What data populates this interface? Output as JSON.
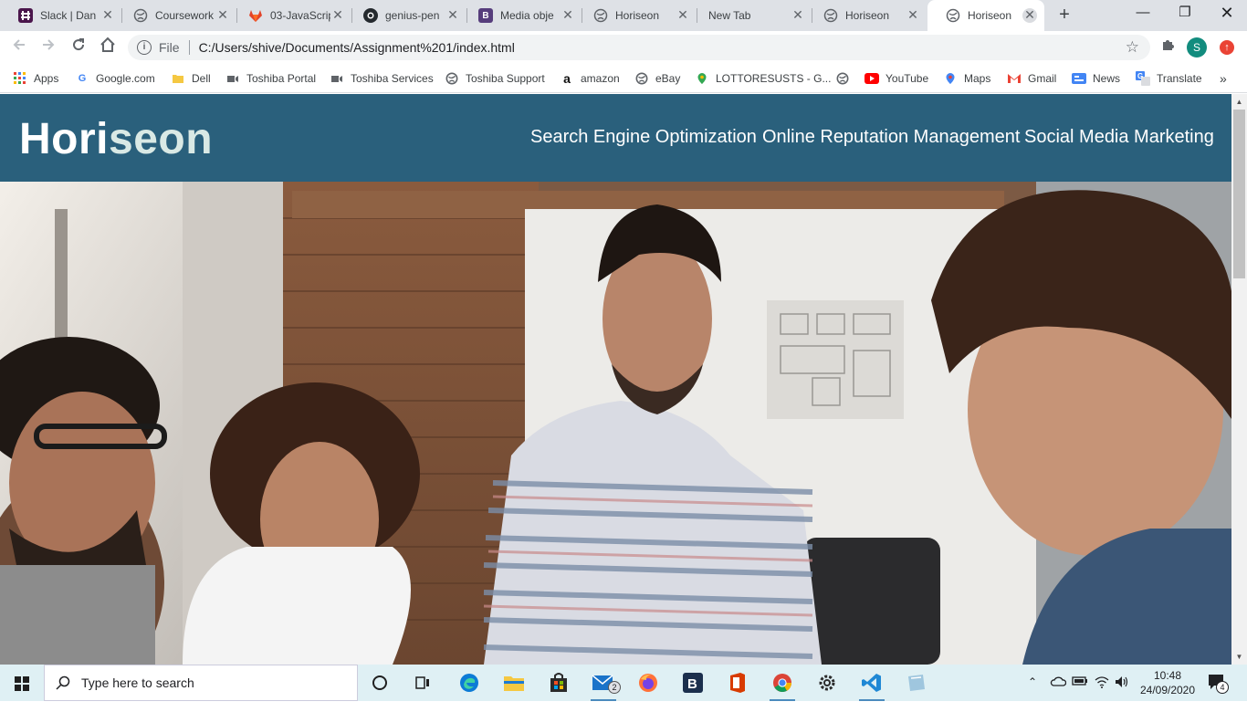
{
  "browser": {
    "tabs": [
      {
        "title": "Slack | Dan",
        "icon": "slack-icon"
      },
      {
        "title": "Coursework",
        "icon": "globe-icon"
      },
      {
        "title": "03-JavaScrip",
        "icon": "gitlab-icon"
      },
      {
        "title": "genius-pen",
        "icon": "github-icon"
      },
      {
        "title": "Media obje",
        "icon": "bootstrap-icon"
      },
      {
        "title": "Horiseon",
        "icon": "globe-icon"
      },
      {
        "title": "New Tab",
        "icon": ""
      },
      {
        "title": "Horiseon",
        "icon": "globe-icon"
      },
      {
        "title": "Horiseon",
        "icon": "globe-icon",
        "active": true
      }
    ],
    "address": {
      "scheme_label": "File",
      "url": "C:/Users/shive/Documents/Assignment%201/index.html"
    },
    "profile_initial": "S",
    "bookmarks": [
      {
        "label": "Apps",
        "icon": "apps-grid-icon"
      },
      {
        "label": "Google.com",
        "icon": "google-icon"
      },
      {
        "label": "Dell",
        "icon": "folder-icon"
      },
      {
        "label": "Toshiba Portal",
        "icon": "toshiba-icon"
      },
      {
        "label": "Toshiba Services",
        "icon": "toshiba-icon"
      },
      {
        "label": "Toshiba Support",
        "icon": "globe-icon"
      },
      {
        "label": "amazon",
        "icon": "amazon-icon"
      },
      {
        "label": "eBay",
        "icon": "globe-icon"
      },
      {
        "label": "LOTTORESUSTS - G...",
        "icon": "maps-pin-icon"
      },
      {
        "label": "",
        "icon": "globe-icon"
      },
      {
        "label": "YouTube",
        "icon": "youtube-icon"
      },
      {
        "label": "Maps",
        "icon": "maps-pin-icon"
      },
      {
        "label": "Gmail",
        "icon": "gmail-icon"
      },
      {
        "label": "News",
        "icon": "news-icon"
      },
      {
        "label": "Translate",
        "icon": "translate-icon"
      }
    ]
  },
  "site": {
    "logo_main": "Hori",
    "logo_accent": "seon",
    "nav": [
      "Search Engine Optimization",
      "Online Reputation Management",
      "Social Media Marketing"
    ],
    "colors": {
      "header_bg": "#2a607c",
      "logo_accent": "#d9e9e5"
    }
  },
  "taskbar": {
    "search_placeholder": "Type here to search",
    "mail_badge": "2",
    "time": "10:48",
    "date": "24/09/2020",
    "notification_count": "4",
    "accent": "#4b8bbe"
  }
}
